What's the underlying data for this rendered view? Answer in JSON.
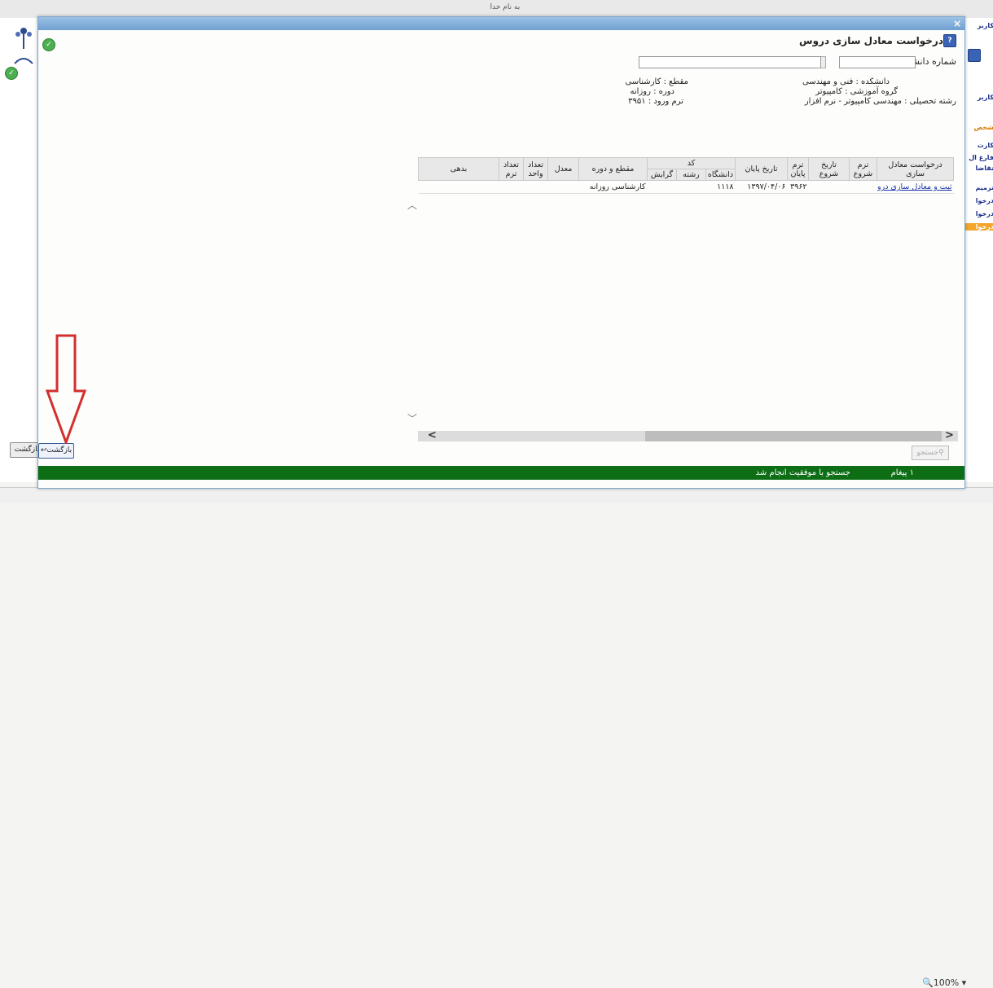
{
  "background": {
    "bismillah": "به نام خدا",
    "back_label": "بازگشت",
    "zoom": "100%",
    "right_menu": [
      "کاربر",
      "کاربر",
      "شخص",
      "کارت",
      "فارغ ال",
      "تقاضا",
      "ترمیم",
      "درخوا",
      "درخوا",
      "درخوا"
    ]
  },
  "dialog": {
    "close": "×",
    "title": "درخواست معادل سازی دروس",
    "help_icon": "help-icon",
    "student_no_label": "شماره دانشجو",
    "student_no_value": "",
    "student_name_value": "",
    "info": {
      "college": "دانشکده : فنی و مهندسی",
      "group": "گروه آموزشی : کامپیوتر",
      "major": "رشته تحصیلی : مهندسی کامپیوتر - نرم افزار",
      "degree": "مقطع : کارشناسی",
      "course": "دوره : روزانه",
      "entry_term": "ترم ورود : ۳۹۵۱"
    },
    "table": {
      "headers": {
        "request": "درخواست معادل سازی",
        "start_term": "ترم شروع",
        "start_date": "تاریخ شروع",
        "end_term": "ترم پایان",
        "end_date": "تاریخ پایان",
        "code": "کد",
        "university": "دانشگاه",
        "field": "رشته",
        "branch": "گرایش",
        "degree_course": "مقطع و دوره",
        "gpa": "معدل",
        "units": "تعداد واحد",
        "terms": "تعداد ترم",
        "debt": "بدهی"
      },
      "rows": [
        {
          "request": "ثبت و معادل سازی دروس",
          "start_term": "",
          "start_date": "",
          "end_term": "۳۹۶۲",
          "end_date": "۱۳۹۷/۰۴/۰۶",
          "university": "۱۱۱۸",
          "field": "",
          "branch": "",
          "degree_course": "کارشناسی روزانه",
          "gpa": "",
          "units": "",
          "terms": "",
          "debt": ""
        }
      ]
    },
    "search_label": "جستجو",
    "back_label": "بازگشت",
    "status": {
      "count": "۱ پیغام",
      "message": "جستجو با موفقیت انجام شد"
    }
  },
  "colors": {
    "status_green": "#0d6e16",
    "titlebar_blue": "#6f9fd0",
    "annotation_red": "#d32f2f"
  }
}
